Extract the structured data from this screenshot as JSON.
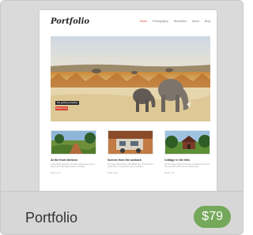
{
  "card": {
    "title": "Portfolio",
    "price": "$79"
  },
  "site": {
    "logo": "Portfolio",
    "nav": [
      "Home",
      "Photography",
      "Illustration",
      "About",
      "Blog"
    ],
    "hero": {
      "caption": "My getting paradise",
      "button": "Read more"
    },
    "posts": [
      {
        "title": "At the front division",
        "text": "A wonderful serenity has taken possession of my entire soul, like these sweet mornings.",
        "more": "Read more"
      },
      {
        "title": "Scenes from the outback",
        "text": "The copy warned the Little Blind Text, that where it came from it would have been rewritten.",
        "more": "Read more"
      },
      {
        "title": "Cottage in the hills",
        "text": "Far far away, behind the word mountains, far from the countries there live the blind texts.",
        "more": "Read more"
      }
    ]
  },
  "colors": {
    "price_badge": "#74a85a",
    "accent": "#d9432f"
  }
}
